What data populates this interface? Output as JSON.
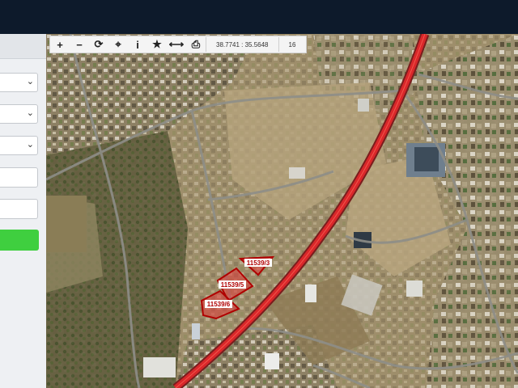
{
  "toolbar": {
    "coordinates": "38.7741 : 35.5648",
    "zoom_level": "16"
  },
  "parcels": [
    {
      "label": "11539/3"
    },
    {
      "label": "11539/5"
    },
    {
      "label": "11539/6"
    }
  ],
  "colors": {
    "topbar": "#0d1a2b",
    "highway": "#d9272a",
    "search_button": "#3fcf3f"
  }
}
